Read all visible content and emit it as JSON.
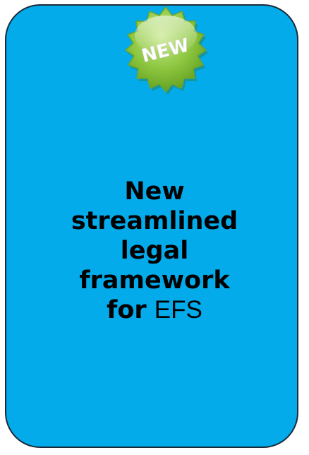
{
  "badge": {
    "text": "NEW",
    "icon": "new-starburst-icon",
    "color": "#8cc63f"
  },
  "card": {
    "background": "#03abeb"
  },
  "headline": {
    "line1": "New",
    "line2": "streamlined",
    "line3": "legal",
    "line4": "framework",
    "line5_bold": "for",
    "line5_regular": "EFS"
  }
}
